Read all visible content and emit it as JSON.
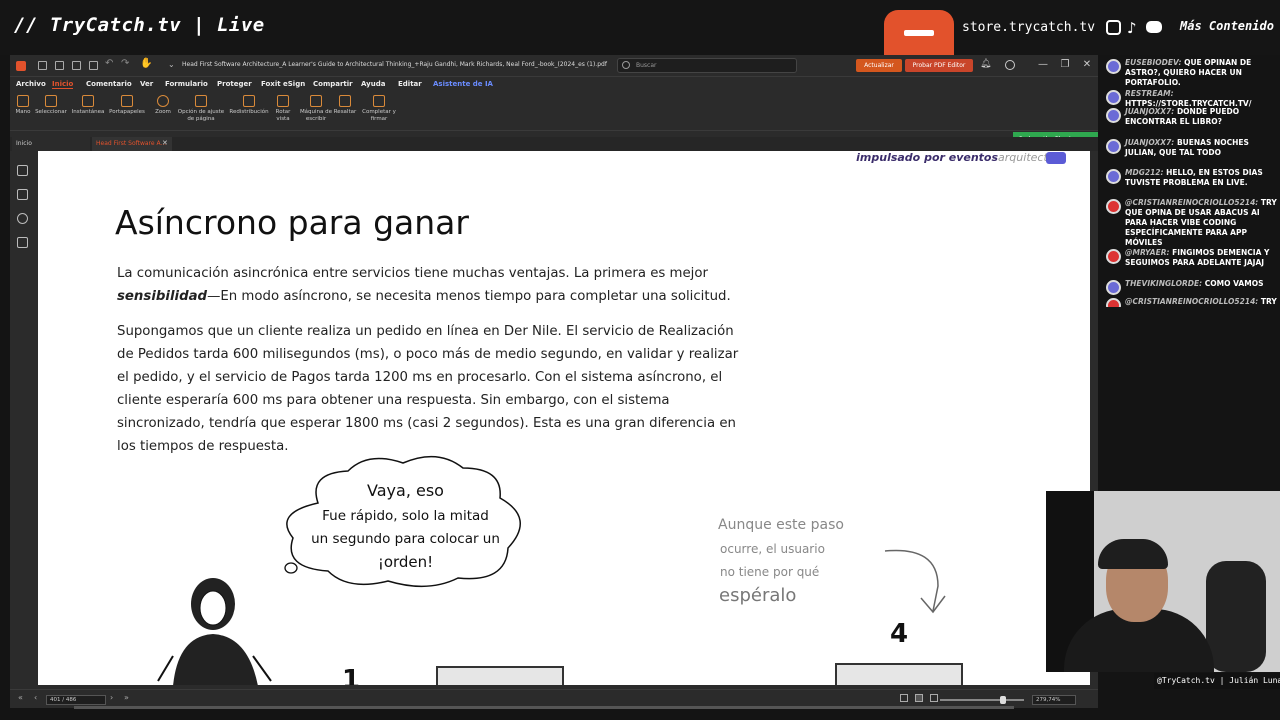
{
  "stream": {
    "brand": "// TryCatch.tv | Live",
    "store_url": "store.trycatch.tv",
    "more_content": "Más Contenido",
    "social_icons": [
      "instagram-icon",
      "tiktok-icon",
      "youtube-icon"
    ],
    "camera_credit": "@TryCatch.tv | Julián Luna"
  },
  "app": {
    "document_title": "Head First Software Architecture_A Learner's Guide to Architectural Thinking_+Raju Gandhi, Mark Richards, Neal Ford_-book_(2024_es (1).pdf",
    "search_placeholder": "Buscar",
    "update_label": "Actualizar",
    "try_editor_label": "Probar PDF Editor",
    "menu": [
      "Archivo",
      "Inicio",
      "Comentario",
      "Ver",
      "Formulario",
      "Proteger",
      "Foxit eSign",
      "Compartir",
      "Ayuda",
      "Editar",
      "Asistente de IA"
    ],
    "ribbon": [
      {
        "label": "Mano"
      },
      {
        "label": "Seleccionar"
      },
      {
        "label": "Instantánea"
      },
      {
        "label": "Portapapeles"
      },
      {
        "label": "Zoom"
      },
      {
        "label": "Opción de ajuste de página"
      },
      {
        "label": "Redistribución"
      },
      {
        "label": "Rotar vista"
      },
      {
        "label": "Máquina de escribir"
      },
      {
        "label": "Resaltar"
      },
      {
        "label": "Completar y firmar"
      }
    ],
    "tabs": [
      "Inicio",
      "Head First Software A..."
    ],
    "reduce_file_size": "Reduce the file size",
    "page_number": "401 / 486",
    "zoom_level": "279,74%",
    "accent_color": "#e2522c"
  },
  "pdf": {
    "section_tag_bold": "impulsado por eventos",
    "section_tag_light": "arquitectura",
    "title": "Asíncrono para ganar",
    "para1_a": "La comunicación asincrónica entre servicios tiene muchas ventajas. La primera es mejor",
    "para1_bold": "sensibilidad",
    "para1_b": "—En modo asíncrono, se necesita menos tiempo para completar una solicitud.",
    "para2": "Supongamos que un cliente realiza un pedido en línea en Der Nile. El servicio de Realización de Pedidos tarda 600 milisegundos (ms), o poco más de medio segundo, en validar y realizar el pedido, y el servicio de Pagos tarda 1200 ms en procesarlo. Con el sistema asíncrono, el cliente esperaría 600 ms para obtener una respuesta. Sin embargo, con el sistema sincronizado, tendría que esperar 1800 ms (casi 2 segundos). Esta es una gran diferencia en los tiempos de respuesta.",
    "bubble_line1": "Vaya, eso",
    "bubble_line2": "Fue rápido, solo la mitad",
    "bubble_line3": "un segundo para colocar un",
    "bubble_line4": "¡orden!",
    "aside_line1": "Aunque este paso",
    "aside_line2": "ocurre, el usuario",
    "aside_line3": "no tiene por qué",
    "aside_line4": "espéralo",
    "step_4": "4",
    "step_1": "1"
  },
  "chat": [
    {
      "user": "Eusebiodev:",
      "text": "Que opinan de Astro?, quiero hacer un portafolio.",
      "platform": "twitch"
    },
    {
      "user": "restream:",
      "text": "https://store.trycatch.tv/",
      "platform": "twitch"
    },
    {
      "user": "juanjoxx7:",
      "text": "Donde puedo encontrar el libro?",
      "platform": "twitch"
    },
    {
      "user": "juanjoxx7:",
      "text": "buenas noches Julian, que tal todo",
      "platform": "twitch"
    },
    {
      "user": "mdg212:",
      "text": "Hello, en estos dias tuviste problema en live.",
      "platform": "twitch"
    },
    {
      "user": "@CristianReinoCriollo5214:",
      "text": "try que opina de usar abacus AI para hacer vibe coding específicamente para app móviles",
      "platform": "youtube"
    },
    {
      "user": "@mryaer:",
      "text": "Fingimos demencia y seguimos para adelante jajaj",
      "platform": "youtube"
    },
    {
      "user": "TheVikingLorde:",
      "text": "como vamos",
      "platform": "twitch"
    },
    {
      "user": "@CristianReinoCriollo5214:",
      "text": "try que se",
      "platform": "youtube"
    }
  ]
}
